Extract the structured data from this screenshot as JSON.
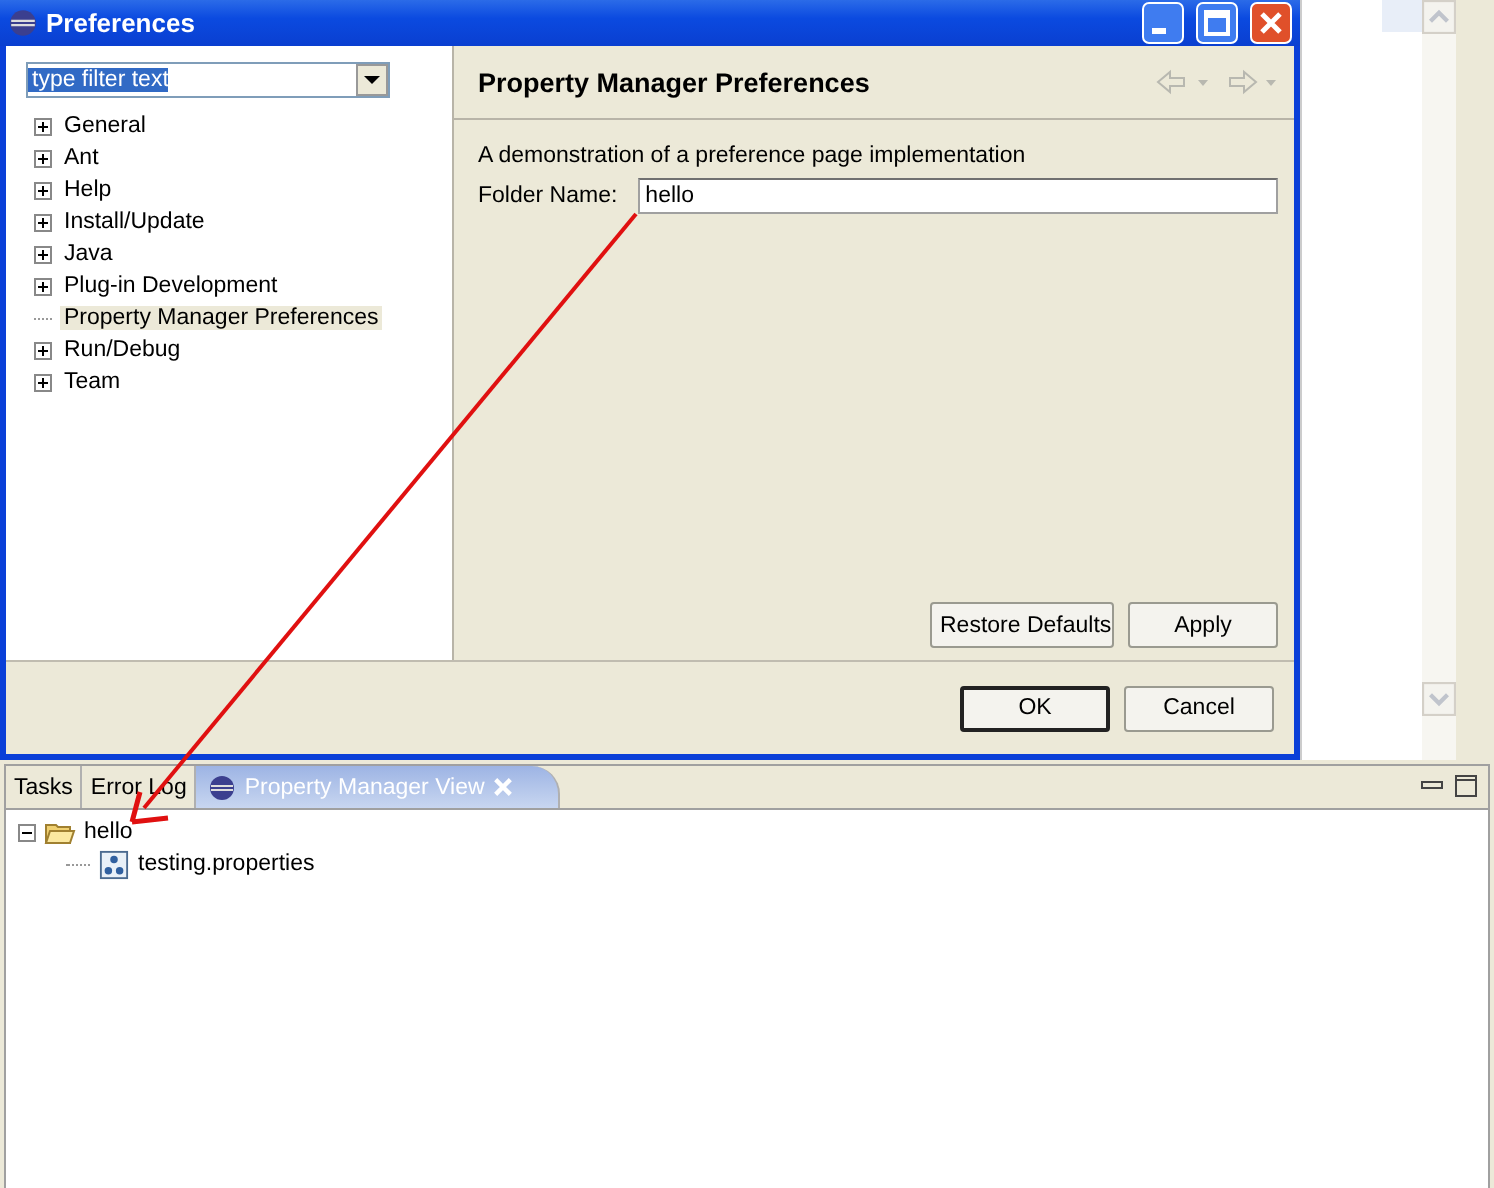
{
  "dialog": {
    "title": "Preferences",
    "filter": {
      "value": "type filter text",
      "selected": true
    },
    "tree": [
      {
        "label": "General",
        "expandable": true,
        "selected": false
      },
      {
        "label": "Ant",
        "expandable": true,
        "selected": false
      },
      {
        "label": "Help",
        "expandable": true,
        "selected": false
      },
      {
        "label": "Install/Update",
        "expandable": true,
        "selected": false
      },
      {
        "label": "Java",
        "expandable": true,
        "selected": false
      },
      {
        "label": "Plug-in Development",
        "expandable": true,
        "selected": false
      },
      {
        "label": "Property Manager Preferences",
        "expandable": false,
        "selected": true
      },
      {
        "label": "Run/Debug",
        "expandable": true,
        "selected": false
      },
      {
        "label": "Team",
        "expandable": true,
        "selected": false
      }
    ],
    "page_title": "Property Manager Preferences",
    "description": "A demonstration of a preference page implementation",
    "folder_field": {
      "label": "Folder Name:",
      "value": "hello"
    },
    "page_buttons": [
      "Restore Defaults",
      "Apply"
    ],
    "buttons": [
      {
        "label": "OK",
        "default": true
      },
      {
        "label": "Cancel",
        "default": false
      }
    ]
  },
  "view": {
    "tabs": [
      {
        "label": "Tasks",
        "selected": false,
        "closable": false
      },
      {
        "label": "Error Log",
        "selected": false,
        "closable": false
      },
      {
        "label": "Property Manager View",
        "selected": true,
        "closable": true
      }
    ],
    "tree": [
      {
        "label": "hello",
        "kind": "folder",
        "expanded": true,
        "children": [
          {
            "label": "testing.properties",
            "kind": "file"
          }
        ]
      }
    ]
  }
}
